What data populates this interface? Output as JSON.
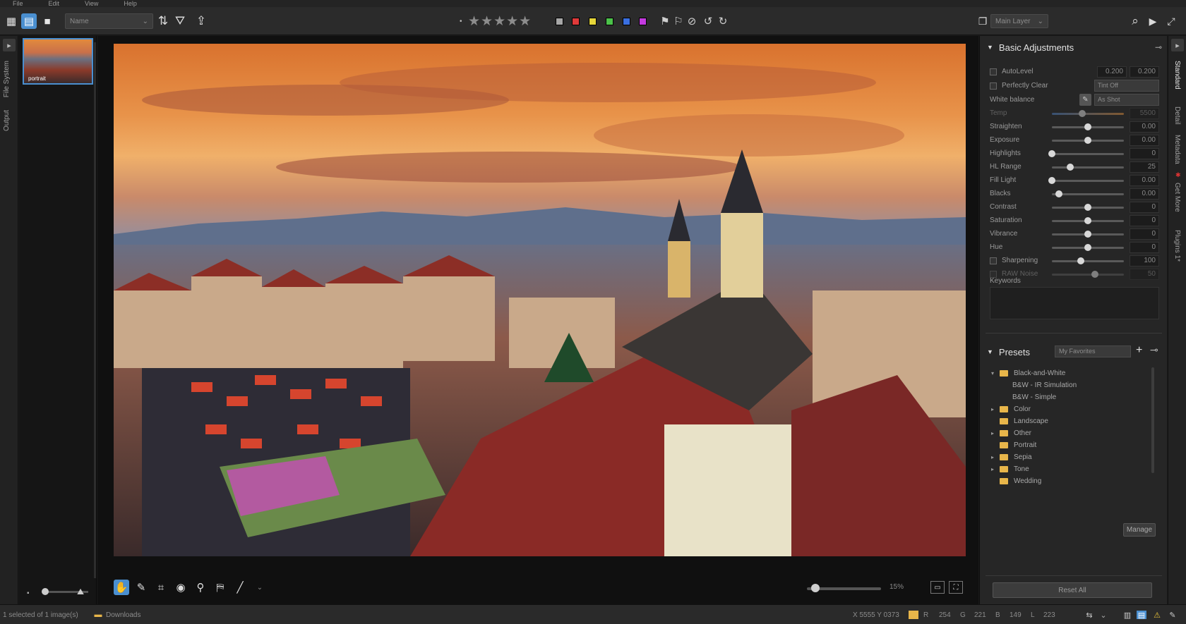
{
  "menu": [
    "File",
    "Edit",
    "View",
    "Help"
  ],
  "toolbar": {
    "sort_value": "Name",
    "rating_dot": "•",
    "stars": "★★★★★",
    "color_labels": [
      "#a7a7a7",
      "#e03a3a",
      "#e6d63a",
      "#4cc24a",
      "#3a6fe0",
      "#c43ae0"
    ],
    "layer_value": "Main Layer"
  },
  "left_tabs": [
    "File System",
    "Output"
  ],
  "filmstrip": {
    "thumb_label": "portrait"
  },
  "viewer": {
    "zoom_value": "15%"
  },
  "basic_adjustments": {
    "title": "Basic Adjustments",
    "auto_level": {
      "label": "AutoLevel",
      "v1": "0.200",
      "v2": "0.200"
    },
    "perfectly_clear": {
      "label": "Perfectly Clear",
      "value": "Tint Off"
    },
    "white_balance": {
      "label": "White balance",
      "value": "As Shot"
    },
    "sliders": [
      {
        "label": "Temp",
        "value": "5500",
        "level": 0.42,
        "dim": true,
        "gradient": true
      },
      {
        "label": "Straighten",
        "value": "0.00",
        "level": 0.5
      },
      {
        "label": "Exposure",
        "value": "0.00",
        "level": 0.5
      },
      {
        "label": "Highlights",
        "value": "0",
        "level": 0.0
      },
      {
        "label": "HL Range",
        "value": "25",
        "level": 0.25
      },
      {
        "label": "Fill Light",
        "value": "0.00",
        "level": 0.0
      },
      {
        "label": "Blacks",
        "value": "0.00",
        "level": 0.1
      },
      {
        "label": "Contrast",
        "value": "0",
        "level": 0.5
      },
      {
        "label": "Saturation",
        "value": "0",
        "level": 0.5
      },
      {
        "label": "Vibrance",
        "value": "0",
        "level": 0.5
      },
      {
        "label": "Hue",
        "value": "0",
        "level": 0.5
      },
      {
        "label": "Sharpening",
        "value": "100",
        "level": 0.4,
        "checkbox": true
      },
      {
        "label": "RAW Noise",
        "value": "50",
        "level": 0.6,
        "checkbox": true,
        "dim": true
      }
    ],
    "keywords_label": "Keywords"
  },
  "presets": {
    "title": "Presets",
    "filter_value": "My Favorites",
    "tree": [
      {
        "label": "Black-and-White",
        "type": "folder",
        "expanded": true
      },
      {
        "label": "B&W - IR Simulation",
        "type": "item"
      },
      {
        "label": "B&W - Simple",
        "type": "item"
      },
      {
        "label": "Color",
        "type": "folder",
        "expanded": false
      },
      {
        "label": "Landscape",
        "type": "folder",
        "expanded": false,
        "leaf": true
      },
      {
        "label": "Other",
        "type": "folder",
        "expanded": false
      },
      {
        "label": "Portrait",
        "type": "folder",
        "expanded": false,
        "leaf": true
      },
      {
        "label": "Sepia",
        "type": "folder",
        "expanded": false
      },
      {
        "label": "Tone",
        "type": "folder",
        "expanded": false
      },
      {
        "label": "Wedding",
        "type": "folder",
        "expanded": false,
        "leaf": true
      }
    ],
    "manage_label": "Manage",
    "reset_label": "Reset All"
  },
  "right_tabs": [
    "Standard",
    "Detail",
    "Metadata",
    "Get More",
    "Plugins 1*"
  ],
  "status": {
    "selection": "1 selected of 1 image(s)",
    "folder": "Downloads",
    "coords": "X 5555  Y 0373",
    "r_label": "R",
    "r_value": "254",
    "g_label": "G",
    "g_value": "221",
    "b_label": "B",
    "b_value": "149",
    "l_label": "L",
    "l_value": "223"
  },
  "colors": {
    "accent": "#4a8fd0",
    "folder": "#e8b64a"
  }
}
